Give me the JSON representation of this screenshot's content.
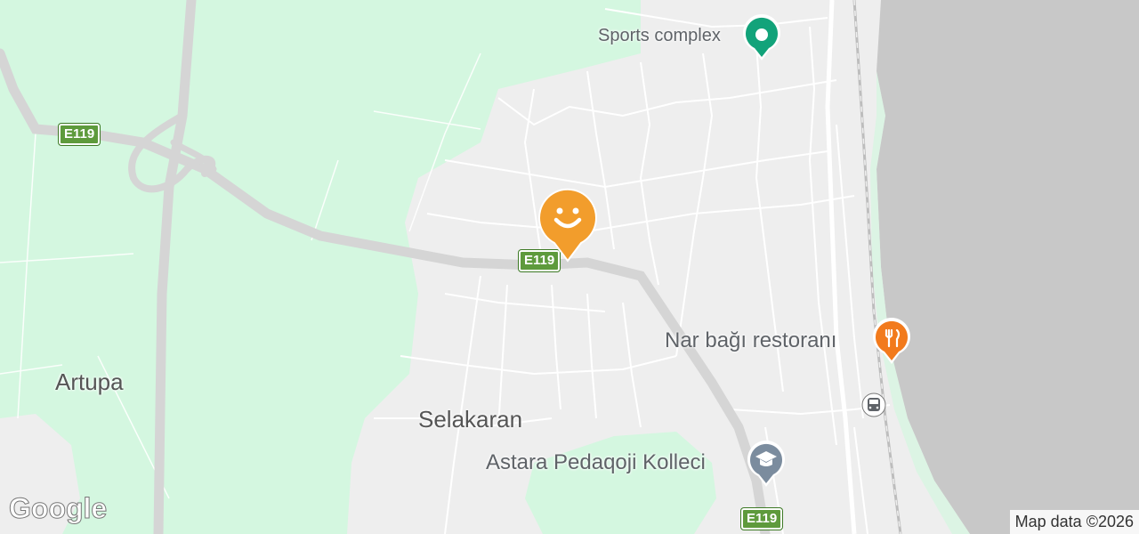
{
  "map": {
    "roads": {
      "highway_label": "E119"
    },
    "places": {
      "artupa": "Artupa",
      "selakaran": "Selakaran"
    },
    "pois": {
      "sports_complex": "Sports complex",
      "restaurant": "Nar bağı restoranı",
      "college": "Astara Pedaqoji Kolleci"
    },
    "colors": {
      "water": "#c8c8c8",
      "park": "#d4f7e0",
      "land": "#eeeeee",
      "road": "#ffffff",
      "highway": "#d5d5d5",
      "marker_orange": "#f29d2c",
      "poi_green": "#12a37a",
      "poi_school": "#7b8c9e"
    }
  },
  "logo": "Google",
  "attribution": "Map data ©2026"
}
